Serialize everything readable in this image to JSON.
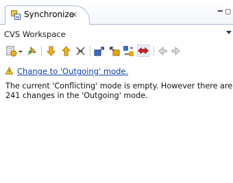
{
  "tab": {
    "title": "Synchronize",
    "close_glyph": "⨯",
    "icon": "synchronize-view-icon"
  },
  "view_controls": {
    "minimize_glyph": "━",
    "maximize_glyph": "◻"
  },
  "view": {
    "title": "CVS Workspace"
  },
  "toolbar": {
    "icons": [
      "synchronize-icon",
      "dropdown-arrow-icon",
      "pin-icon",
      "next-difference-icon",
      "previous-difference-icon",
      "collapse-all-icon",
      "incoming-mode-icon",
      "outgoing-mode-icon",
      "incoming-outgoing-mode-icon",
      "conflicts-mode-icon",
      "commit-icon",
      "update-icon"
    ]
  },
  "info": {
    "link_text": "Change to 'Outgoing' mode.",
    "message_line1": "The current 'Conflicting' mode is empty. However there are",
    "message_line2": "241 changes in the 'Outgoing' mode."
  },
  "colors": {
    "link": "#0b3fa8",
    "border": "#a9b8d3",
    "conflict_red": "#d8232a",
    "arrow_yellow": "#e8a317"
  }
}
